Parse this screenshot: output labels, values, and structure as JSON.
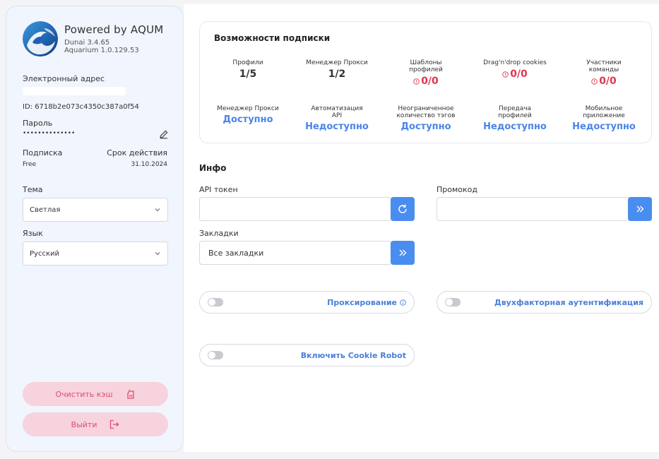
{
  "sidebar": {
    "brand_title": "Powered by AQUM",
    "version_dunai": "Dunai 3.4.65",
    "version_aquarium": "Aquarium 1.0.129.53",
    "email_label": "Электронный адрес",
    "id_text": "ID: 6718b2e073c4350c387a0f54",
    "password_label": "Пароль",
    "password_value": "••••••••••••••",
    "subscription_label": "Подписка",
    "subscription_value": "Free",
    "expiry_label": "Срок действия",
    "expiry_value": "31.10.2024",
    "theme_label": "Тема",
    "theme_value": "Светлая",
    "language_label": "Язык",
    "language_value": "Русский",
    "clear_cache_label": "Очистить кэш",
    "logout_label": "Выйти"
  },
  "subscription": {
    "title": "Возможности подписки",
    "row1": [
      {
        "label": "Профили",
        "value": "1/5",
        "warn": false
      },
      {
        "label": "Менеджер Прокси",
        "value": "1/2",
        "warn": false
      },
      {
        "label": "Шаблоны профилей",
        "value": "0/0",
        "warn": true
      },
      {
        "label": "Drag'n'drop cookies",
        "value": "0/0",
        "warn": true
      },
      {
        "label": "Участники команды",
        "value": "0/0",
        "warn": true
      }
    ],
    "row2": [
      {
        "label": "Менеджер Прокси",
        "value": "Доступно"
      },
      {
        "label": "Автоматизация API",
        "value": "Недоступно"
      },
      {
        "label": "Неограниченное количество тэгов",
        "value": "Доступно"
      },
      {
        "label": "Передача профилей",
        "value": "Недоступно"
      },
      {
        "label": "Мобильное приложение",
        "value": "Недоступно"
      }
    ]
  },
  "info": {
    "title": "Инфо",
    "api_token_label": "API токен",
    "api_token_value": "",
    "promo_label": "Промокод",
    "promo_value": "",
    "bookmarks_label": "Закладки",
    "bookmarks_value": "Все закладки",
    "proxy_toggle_label": "Проксирование",
    "twofa_toggle_label": "Двухфакторная аутентификация",
    "cookie_robot_label": "Включить Cookie Robot"
  },
  "colors": {
    "accent_blue": "#4a8df0",
    "warn_red": "#e0354f",
    "pink_button": "#f6d3dd",
    "pink_text": "#e04d6f"
  }
}
